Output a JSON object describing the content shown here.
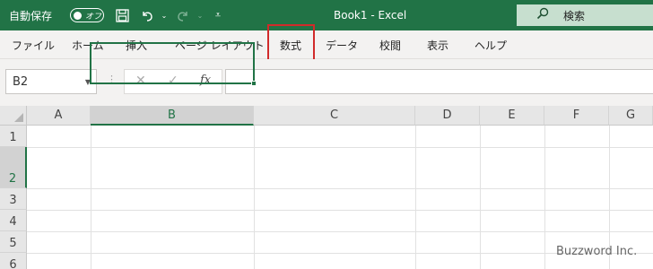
{
  "titlebar": {
    "autosave_label": "自動保存",
    "autosave_state": "オフ",
    "title": "Book1  -  Excel",
    "search_label": "検索",
    "color": "#217346",
    "icons": [
      "save-icon",
      "undo-icon",
      "redo-icon",
      "customize-quick-access-icon",
      "search-icon"
    ]
  },
  "ribbon": {
    "tabs": [
      "ファイル",
      "ホーム",
      "挿入",
      "ページ レイアウト",
      "数式",
      "データ",
      "校閲",
      "表示",
      "ヘルプ"
    ],
    "highlighted_tab": "数式",
    "highlight_color": "#d12a2a"
  },
  "formula_bar": {
    "name_box": "B2",
    "fx_label": "fx",
    "formula": ""
  },
  "sheet": {
    "columns": [
      "A",
      "B",
      "C",
      "D",
      "E",
      "F",
      "G"
    ],
    "rows": [
      "1",
      "2",
      "3",
      "4",
      "5",
      "6"
    ],
    "selected_cell": "B2"
  },
  "watermark": "Buzzword Inc."
}
